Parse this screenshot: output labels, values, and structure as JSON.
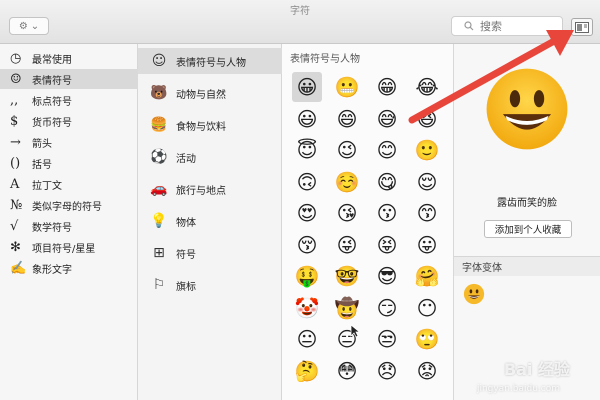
{
  "window": {
    "title": "字符"
  },
  "toolbar": {
    "gear_label": "⚙",
    "dropdown_label": "⌄",
    "search_placeholder": "搜索"
  },
  "sidebar": {
    "items": [
      {
        "icon": "◷",
        "icon_name": "clock-icon",
        "label": "最常使用"
      },
      {
        "icon": "☺",
        "icon_name": "smiley-icon",
        "label": "表情符号"
      },
      {
        "icon": ",,",
        "icon_name": "punctuation-icon",
        "label": "标点符号"
      },
      {
        "icon": "$",
        "icon_name": "dollar-icon",
        "label": "货币符号"
      },
      {
        "icon": "→",
        "icon_name": "arrow-icon",
        "label": "箭头"
      },
      {
        "icon": "()",
        "icon_name": "parentheses-icon",
        "label": "括号"
      },
      {
        "icon": "A",
        "icon_name": "latin-a-icon",
        "label": "拉丁文"
      },
      {
        "icon": "№",
        "icon_name": "numero-icon",
        "label": "类似字母的符号"
      },
      {
        "icon": "√",
        "icon_name": "sqrt-icon",
        "label": "数学符号"
      },
      {
        "icon": "✻",
        "icon_name": "asterisk-icon",
        "label": "项目符号/星星"
      },
      {
        "icon": "✍",
        "icon_name": "pictograph-icon",
        "label": "象形文字"
      }
    ]
  },
  "categories": {
    "items": [
      {
        "icon": "☺",
        "icon_name": "smiley-category-icon",
        "label": "表情符号与人物"
      },
      {
        "icon": "🐻",
        "icon_name": "bear-icon",
        "label": "动物与自然"
      },
      {
        "icon": "🍔",
        "icon_name": "burger-icon",
        "label": "食物与饮料"
      },
      {
        "icon": "⚽",
        "icon_name": "soccer-ball-icon",
        "label": "活动"
      },
      {
        "icon": "🚗",
        "icon_name": "car-icon",
        "label": "旅行与地点"
      },
      {
        "icon": "💡",
        "icon_name": "lightbulb-icon",
        "label": "物体"
      },
      {
        "icon": "⊞",
        "icon_name": "symbols-icon",
        "label": "符号"
      },
      {
        "icon": "⚐",
        "icon_name": "flag-icon",
        "label": "旗标"
      }
    ]
  },
  "grid": {
    "title": "表情符号与人物",
    "emojis": [
      "😀",
      "😬",
      "😁",
      "😂",
      "😃",
      "😄",
      "😅",
      "😆",
      "😇",
      "😉",
      "😊",
      "🙂",
      "🙃",
      "☺️",
      "😋",
      "😌",
      "😍",
      "😘",
      "😗",
      "😙",
      "😚",
      "😜",
      "😝",
      "😛",
      "🤑",
      "🤓",
      "😎",
      "🤗",
      "🤡",
      "🤠",
      "😏",
      "😶",
      "😐",
      "😑",
      "😒",
      "🙄",
      "🤔",
      "😳",
      "😞",
      "😟",
      "😠",
      "😡"
    ]
  },
  "detail": {
    "emoji_name": "露齿而笑的脸",
    "favorite_button": "添加到个人收藏",
    "variants_header": "字体变体"
  },
  "watermark": {
    "brand": "Bai 经验",
    "site": "jingyan.baidu.com"
  },
  "colors": {
    "arrow": "#e8463b",
    "emoji_face": "#f8c12e",
    "selected_row": "#d9d9d9"
  }
}
